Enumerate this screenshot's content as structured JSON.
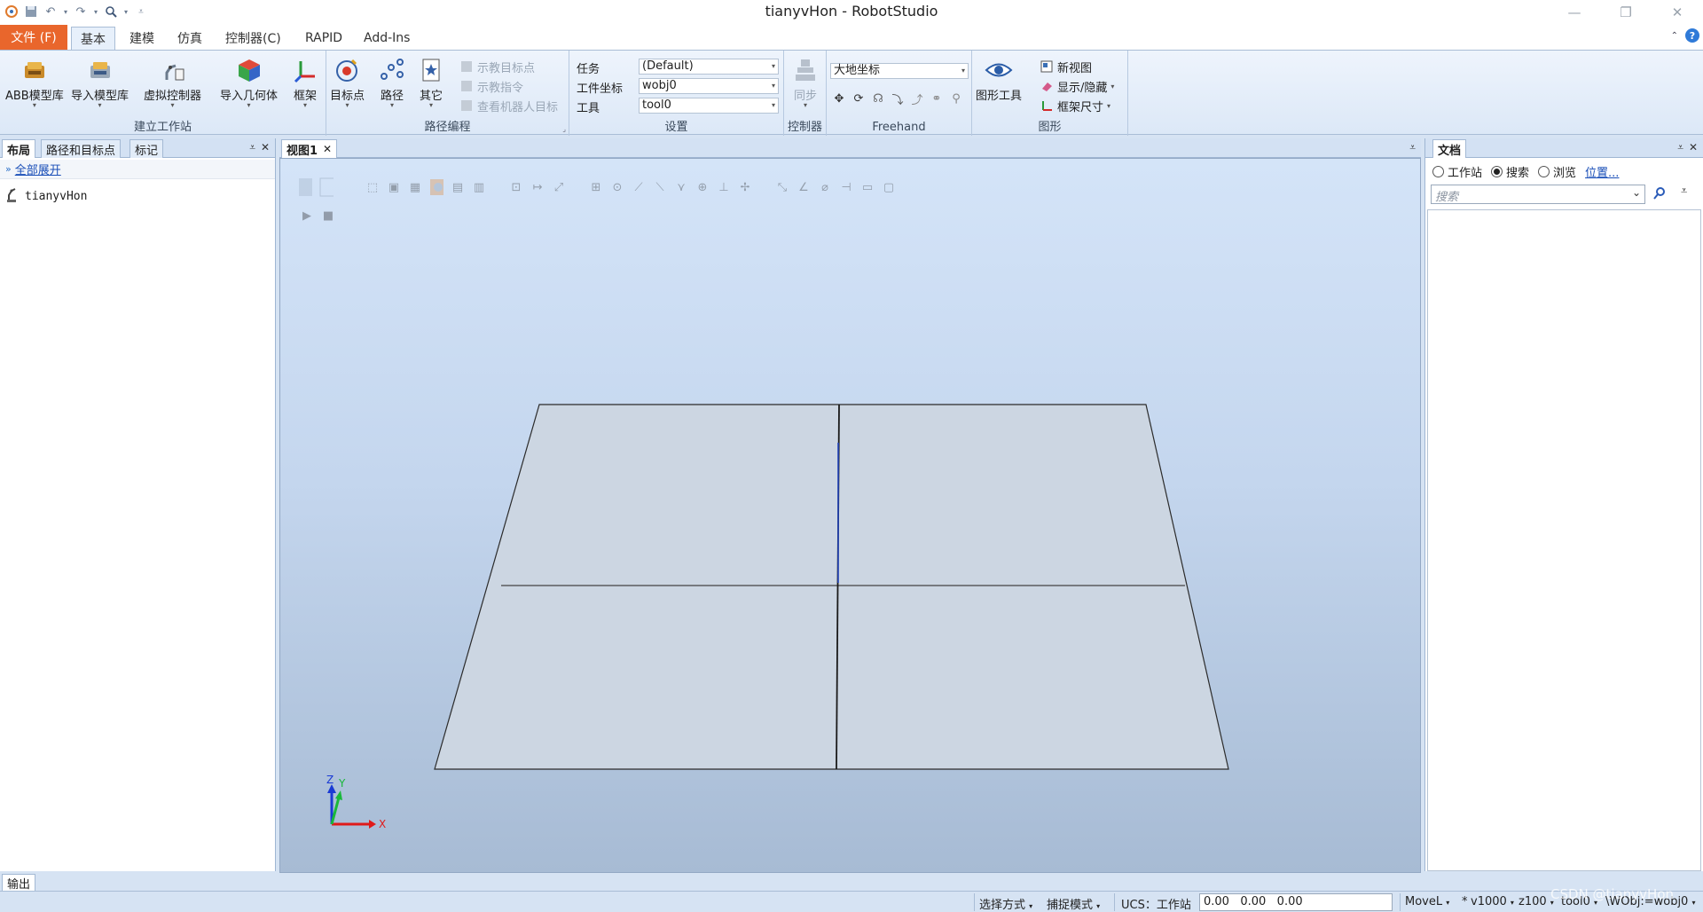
{
  "window": {
    "title": "tianyvHon - RobotStudio"
  },
  "ribbon_tabs": {
    "file": "文件 (F)",
    "basic": "基本",
    "modeling": "建模",
    "simulation": "仿真",
    "controller": "控制器(C)",
    "rapid": "RAPID",
    "addins": "Add-Ins"
  },
  "groups": {
    "build_station": {
      "label": "建立工作站",
      "abb_library": "ABB模型库",
      "import_library": "导入模型库",
      "virtual_controller": "虚拟控制器",
      "import_geometry": "导入几何体",
      "frame": "框架"
    },
    "path_programming": {
      "label": "路径编程",
      "target": "目标点",
      "path": "路径",
      "other": "其它",
      "teach_target": "示教目标点",
      "teach_instruction": "示教指令",
      "view_robot_target": "查看机器人目标"
    },
    "settings": {
      "label": "设置",
      "task_label": "任务",
      "task_value": "(Default)",
      "wobj_label": "工件坐标",
      "wobj_value": "wobj0",
      "tool_label": "工具",
      "tool_value": "tool0"
    },
    "controller": {
      "label": "控制器",
      "sync": "同步"
    },
    "freehand": {
      "label": "Freehand",
      "coord_value": "大地坐标"
    },
    "graphics": {
      "label": "图形",
      "graphics_tools": "图形工具",
      "new_view": "新视图",
      "show_hide": "显示/隐藏",
      "frame_size": "框架尺寸"
    }
  },
  "left_panel": {
    "tabs": [
      "布局",
      "路径和目标点",
      "标记"
    ],
    "expand_all": "全部展开",
    "tree_root": "tianyvHon"
  },
  "viewport": {
    "tab_label": "视图1",
    "axis_x": "X",
    "axis_y": "Y",
    "axis_z": "Z"
  },
  "right_panel": {
    "tab": "文档",
    "radio_station": "工作站",
    "radio_search": "搜索",
    "radio_browse": "浏览",
    "location_link": "位置...",
    "search_placeholder": "搜索"
  },
  "output_tab": "输出",
  "statusbar": {
    "select_mode": "选择方式",
    "snap_mode": "捕捉模式",
    "ucs": "UCS：工作站",
    "coords": "0.00   0.00   0.00",
    "move": "MoveL",
    "speed": "v1000",
    "zone": "z100",
    "tool": "tool0",
    "wobj": "\\WObj:=wobj0",
    "watermark": "CSDN @tianyvHon"
  },
  "colors": {
    "file_tab": "#e9662c",
    "viewport_top": "#d4e4f8",
    "viewport_bottom": "#a7bbd4",
    "floor": "#ccd6e2"
  }
}
